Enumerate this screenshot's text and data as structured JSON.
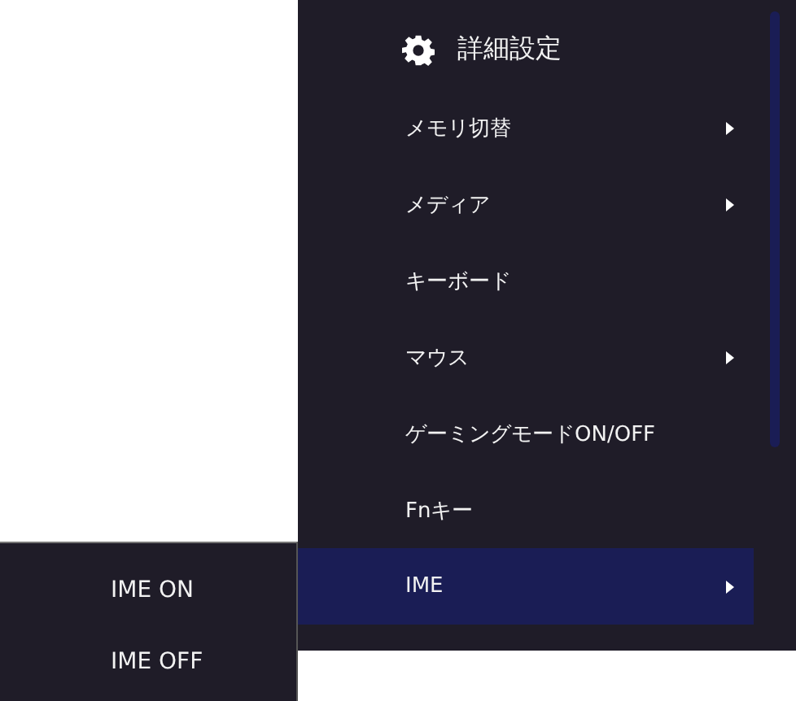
{
  "menu": {
    "header": "詳細設定",
    "items": [
      {
        "label": "メモリ切替",
        "has_submenu": true,
        "selected": false
      },
      {
        "label": "メディア",
        "has_submenu": true,
        "selected": false
      },
      {
        "label": "キーボード",
        "has_submenu": false,
        "selected": false
      },
      {
        "label": "マウス",
        "has_submenu": true,
        "selected": false
      },
      {
        "label": "ゲーミングモードON/OFF",
        "has_submenu": false,
        "selected": false
      },
      {
        "label": "Fnキー",
        "has_submenu": false,
        "selected": false
      },
      {
        "label": "IME",
        "has_submenu": true,
        "selected": true
      }
    ]
  },
  "submenu": {
    "items": [
      {
        "label": "IME ON"
      },
      {
        "label": "IME OFF"
      }
    ]
  }
}
